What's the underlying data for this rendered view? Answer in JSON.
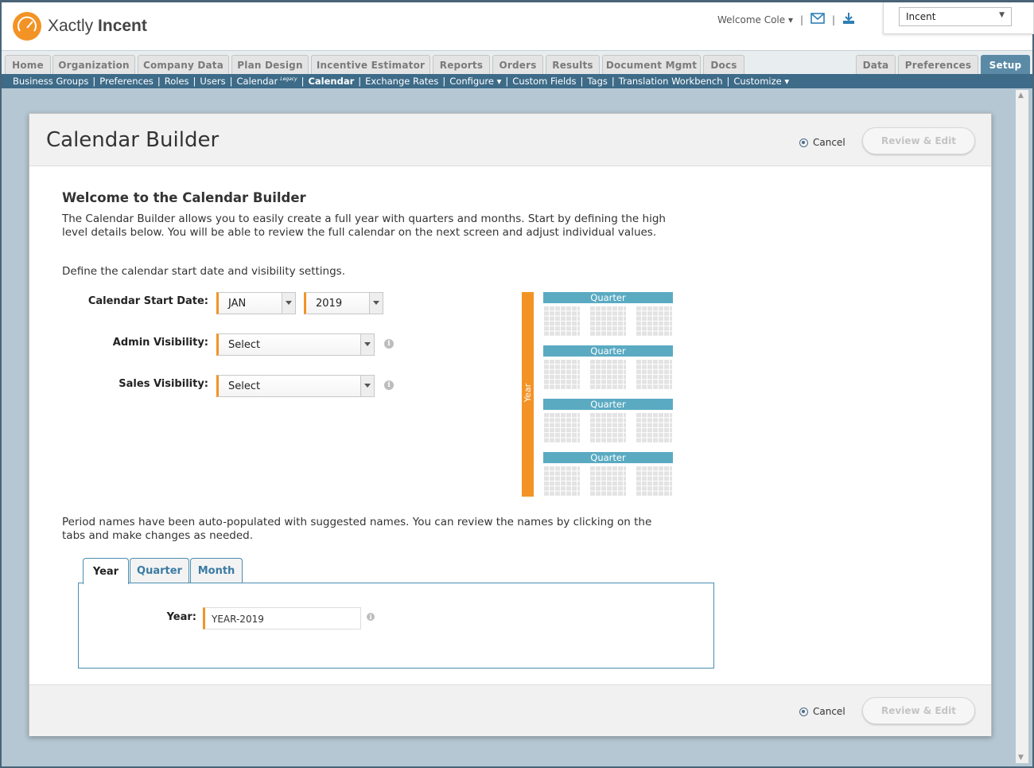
{
  "brand": {
    "name_light": "Xactly",
    "name_bold": "Incent",
    "accent": "#f39325"
  },
  "header": {
    "welcome": "Welcome Cole ▾",
    "separator": "|",
    "app_select_value": "Incent"
  },
  "main_tabs": [
    "Home",
    "Organization",
    "Company Data",
    "Plan Design",
    "Incentive Estimator",
    "Reports",
    "Orders",
    "Results",
    "Document Mgmt",
    "Docs"
  ],
  "right_tabs": [
    "Data",
    "Preferences",
    "Setup"
  ],
  "subnav": {
    "items": [
      "Business Groups",
      "Preferences",
      "Roles",
      "Users",
      "Calendar",
      "Calendar",
      "Exchange Rates",
      "Configure ▾",
      "Custom Fields",
      "Tags",
      "Translation Workbench",
      "Customize ▾"
    ],
    "legacy_sup": "Legacy"
  },
  "page": {
    "title": "Calendar Builder",
    "cancel_label": "Cancel",
    "review_label": "Review & Edit",
    "heading": "Welcome to the Calendar Builder",
    "intro_1": "The Calendar Builder allows you to easily create a full year with quarters and months. Start by defining the high",
    "intro_2": "level details below. You will be able to review the full calendar on the next screen and adjust individual values.",
    "define_text": "Define the calendar start date and visibility settings.",
    "start_date_label": "Calendar Start Date:",
    "start_month": "JAN",
    "start_year": "2019",
    "admin_vis_label": "Admin Visibility:",
    "admin_vis_value": "Select",
    "sales_vis_label": "Sales Visibility:",
    "sales_vis_value": "Select",
    "period_text_1": "Period names have been auto-populated with suggested names. You can review the names by clicking on the",
    "period_text_2": "tabs and make changes as needed.",
    "info_glyph": "i"
  },
  "diagram": {
    "year_label": "Year",
    "quarter_label": "Quarter"
  },
  "period_tabs": [
    "Year",
    "Quarter",
    "Month"
  ],
  "year_field": {
    "label": "Year:",
    "value": "YEAR-2019"
  }
}
